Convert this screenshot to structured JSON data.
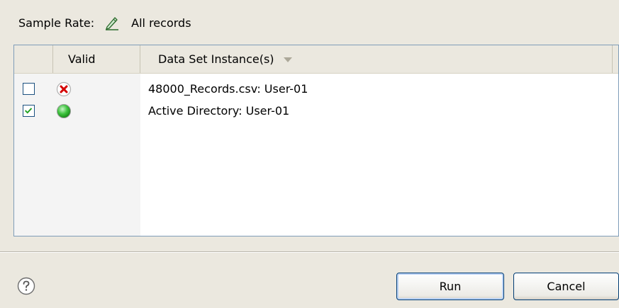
{
  "sample": {
    "label": "Sample Rate:",
    "value": "All records"
  },
  "table": {
    "columns": {
      "valid": "Valid",
      "dataset": "Data Set Instance(s)"
    },
    "rows": [
      {
        "checked": false,
        "status": "invalid",
        "status_icon": "red-x-icon",
        "label": "48000_Records.csv: User-01"
      },
      {
        "checked": true,
        "status": "valid",
        "status_icon": "green-circle-icon",
        "label": "Active Directory: User-01"
      }
    ]
  },
  "footer": {
    "run_label": "Run",
    "cancel_label": "Cancel",
    "help_icon": "help-icon"
  },
  "colors": {
    "background": "#ebe8df",
    "table_border": "#7f9db9",
    "check_mark": "#21a121",
    "invalid_red": "#d40000",
    "valid_green": "#2fbf2f"
  }
}
